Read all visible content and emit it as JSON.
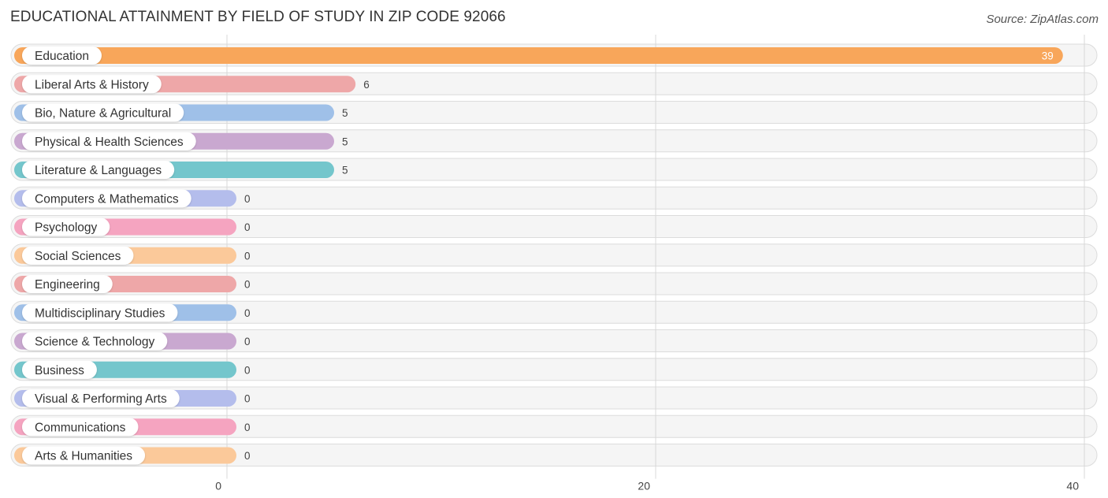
{
  "chart_data": {
    "type": "bar",
    "orientation": "horizontal",
    "title": "EDUCATIONAL ATTAINMENT BY FIELD OF STUDY IN ZIP CODE 92066",
    "source": "Source: ZipAtlas.com",
    "xlabel": "",
    "ylabel": "",
    "xlim": [
      0,
      40
    ],
    "xticks": [
      0,
      20,
      40
    ],
    "xtick_labels": [
      "0",
      "20",
      "40"
    ],
    "grid": true,
    "categories": [
      "Education",
      "Liberal Arts & History",
      "Bio, Nature & Agricultural",
      "Physical & Health Sciences",
      "Literature & Languages",
      "Computers & Mathematics",
      "Psychology",
      "Social Sciences",
      "Engineering",
      "Multidisciplinary Studies",
      "Science & Technology",
      "Business",
      "Visual & Performing Arts",
      "Communications",
      "Arts & Humanities"
    ],
    "values": [
      39,
      6,
      5,
      5,
      5,
      0,
      0,
      0,
      0,
      0,
      0,
      0,
      0,
      0,
      0
    ],
    "value_labels": [
      "39",
      "6",
      "5",
      "5",
      "5",
      "0",
      "0",
      "0",
      "0",
      "0",
      "0",
      "0",
      "0",
      "0",
      "0"
    ],
    "colors": [
      "#f8a65a",
      "#eea7a8",
      "#9fc0e8",
      "#c9a8d0",
      "#74c6cc",
      "#b4bdec",
      "#f5a4c0",
      "#fbc99a",
      "#eea7a8",
      "#9fc0e8",
      "#c9a8d0",
      "#74c6cc",
      "#b4bdec",
      "#f5a4c0",
      "#fbc99a"
    ]
  }
}
